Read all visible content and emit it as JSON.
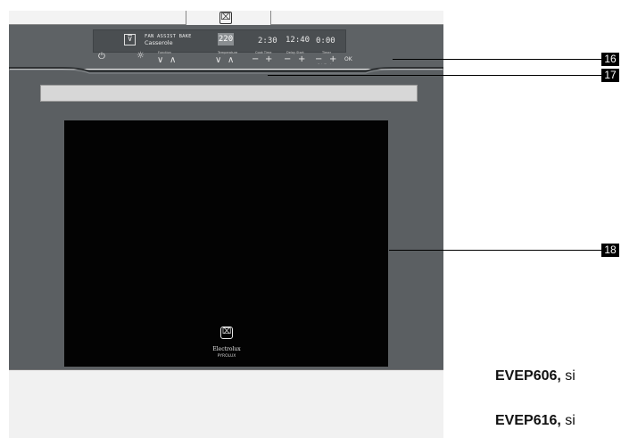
{
  "brand": {
    "logo_glyph": "⌧",
    "name": "Electrolux",
    "sub": "PYROLUX"
  },
  "display": {
    "func_line1": "FAN ASSIST BAKE",
    "func_line2": "Casserole",
    "temperature": "220",
    "time1": "2:30",
    "time2": "12:40",
    "time3": "0:00"
  },
  "controls": {
    "power_symbol": "⏻",
    "light_symbol": "☼",
    "function_label": "Function",
    "function_down": "∨",
    "function_up": "∧",
    "temperature_label": "Temperature",
    "temp_down": "∨",
    "temp_up": "∧",
    "cook_time_label": "Cook Time",
    "cook_minus": "−",
    "cook_plus": "+",
    "delay_start_label": "Delay Start",
    "delay_minus": "−",
    "delay_plus": "+",
    "timer_label": "Timer",
    "timer_minus": "−",
    "timer_plus": "+",
    "set_clock_label": "Set Clock",
    "ok_label": "OK"
  },
  "callouts": [
    "16",
    "17",
    "18"
  ],
  "models": [
    {
      "code": "EVEP606,",
      "suffix": " si"
    },
    {
      "code": "EVEP616,",
      "suffix": " si"
    }
  ]
}
